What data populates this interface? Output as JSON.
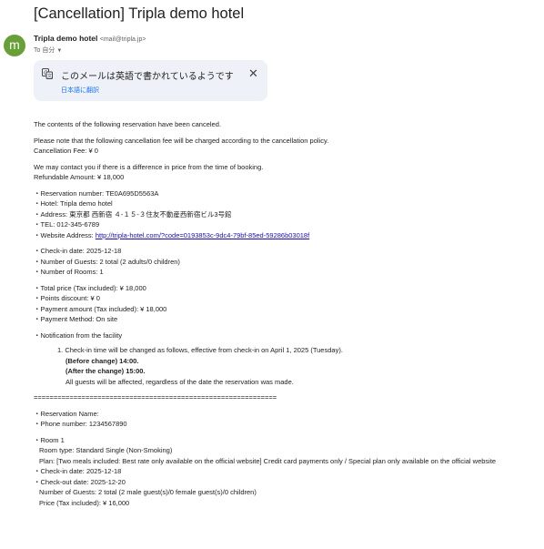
{
  "subject": "[Cancellation] Tripla demo hotel",
  "sender": {
    "avatar_letter": "m",
    "avatar_color": "#689f38",
    "name": "Tripla demo hotel",
    "email": "<mail@tripla.jp>",
    "to": "To 自分"
  },
  "translate": {
    "message": "このメールは英語で書かれているようです",
    "link": "日本語に翻訳",
    "icon": "translate-icon",
    "close_icon": "close-icon"
  },
  "body": {
    "intro": "The contents of the following reservation have been canceled.",
    "fee_note": "Please note that the following cancellation fee will be charged according to the cancellation policy.",
    "fee": "Cancellation Fee: ¥ 0",
    "contact_note": "We may contact you if there is a difference in price from the time of booking.",
    "refund": "Refundable Amount: ¥ 18,000",
    "reservation_number": "・Reservation number: TE0A695D5563A",
    "hotel": "・Hotel: Tripla demo hotel",
    "address": "・Address: 東京都 西新宿 ４-１５-３住友不動産西新宿ビル3号館",
    "tel": "・TEL: 012-345-6789",
    "website_label": "・Website Address: ",
    "website_url": "http://tripla-hotel.com/?code=0193853c-9dc4-79bf-85ed-59286b03018f",
    "checkin": "・Check-in date: 2025-12-18",
    "guests": "・Number of Guests: 2 total (2 adults/0 children)",
    "rooms": "・Number of Rooms: 1",
    "total_price": "・Total price (Tax included): ¥ 18,000",
    "points": "・Points discount: ¥ 0",
    "payment_amount": "・Payment amount (Tax included): ¥ 18,000",
    "payment_method": "・Payment Method: On site",
    "notification_title": "・Notification from the facility",
    "notice_1": "1. Check-in time will be changed as follows, effective from check-in on April 1, 2025 (Tuesday).",
    "notice_before": "(Before change) 14:00.",
    "notice_after": "(After the change) 15:00.",
    "notice_all": "All guests will be affected, regardless of the date the reservation was made.",
    "separator": "=============================================================",
    "res_name": "・Reservation Name:",
    "phone": "・Phone number: 1234567890",
    "room": "・Room 1",
    "room_type": "Room type: Standard Single (Non-Smoking)",
    "plan": "Plan: [Two meals included: Best rate only available on the official website] Credit card payments only / Special plan only available on the official website",
    "room_checkin": "・Check-in date: 2025-12-18",
    "room_checkout": "・Check-out date: 2025-12-20",
    "room_guests": "Number of Guests: 2 total (2 male guest(s)/0 female guest(s)/0 children)",
    "room_price": "Price (Tax included): ¥ 16,000"
  }
}
